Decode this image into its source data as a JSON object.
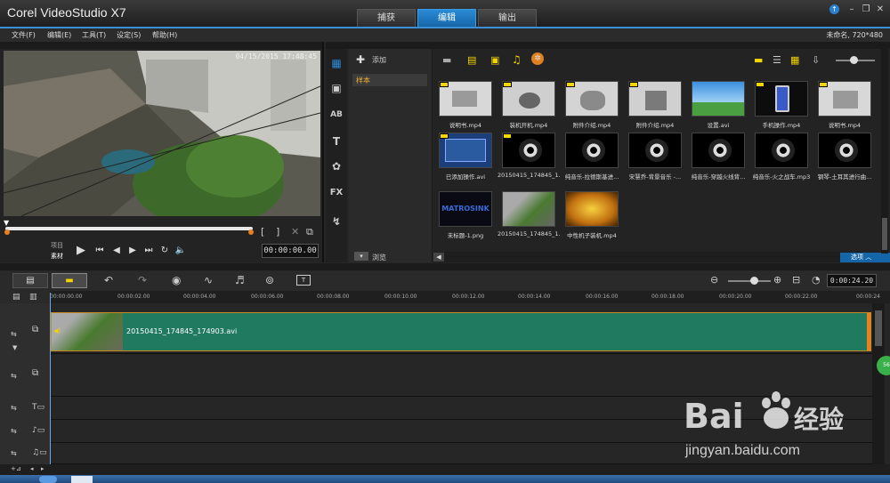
{
  "app": {
    "title": "Corel VideoStudio X7",
    "project_info": "未命名, 720*480"
  },
  "tabs": [
    {
      "label": "捕获"
    },
    {
      "label": "编辑"
    },
    {
      "label": "输出"
    }
  ],
  "menu": [
    {
      "label": "文件(F)"
    },
    {
      "label": "编辑(E)"
    },
    {
      "label": "工具(T)"
    },
    {
      "label": "设定(S)"
    },
    {
      "label": "帮助(H)"
    }
  ],
  "player": {
    "video_timestamp": "04/15/2015 17:48:45",
    "mode_project": "项目",
    "mode_clip": "素材",
    "timecode": "00:00:00.00",
    "bracket_in": "[",
    "bracket_out": "]"
  },
  "library": {
    "add_label": "添加",
    "category": "样本",
    "browse_label": "浏览",
    "options_label": "选项",
    "items": [
      {
        "label": "说明书.mp4",
        "tagged": true
      },
      {
        "label": "装机开机.mp4",
        "tagged": true
      },
      {
        "label": "附件介绍.mp4",
        "tagged": true
      },
      {
        "label": "附件介绍.mp4",
        "tagged": true
      },
      {
        "label": "设置.avi",
        "tagged": false
      },
      {
        "label": "手机操作.mp4",
        "tagged": true
      },
      {
        "label": "说明书.mp4",
        "tagged": true
      },
      {
        "label": "已添加操作.avi",
        "tagged": true
      },
      {
        "label": "20150415_174845_1...",
        "tagged": true
      },
      {
        "label": "纯音乐-拉德斯基进...",
        "tagged": false
      },
      {
        "label": "宋慧乔-背景音乐 -...",
        "tagged": false
      },
      {
        "label": "纯音乐-穿越火线背...",
        "tagged": false
      },
      {
        "label": "纯音乐-火之战车.mp3",
        "tagged": false
      },
      {
        "label": "钢琴-土耳其进行曲...",
        "tagged": false
      },
      {
        "label": "未标题-1.png",
        "tagged": false
      },
      {
        "label": "20150415_174845_1...",
        "tagged": false
      },
      {
        "label": "中性机子装机.mp4",
        "tagged": false
      }
    ]
  },
  "timeline": {
    "zoom_timecode": "0:00:24.20",
    "ruler": [
      "00:00:00.00",
      "00:00:02.00",
      "00:00:04.00",
      "00:00:06.00",
      "00:00:08.00",
      "00:00:10.00",
      "00:00:12.00",
      "00:00:14.00",
      "00:00:16.00",
      "00:00:18.00",
      "00:00:20.00",
      "00:00:22.00",
      "00:00:24"
    ],
    "clip_label": "20150415_174845_174903.avi"
  },
  "watermark": {
    "brand_left": "Bai",
    "brand_right": "经验",
    "url": "jingyan.baidu.com"
  },
  "colors": {
    "accent": "#2a8bd6",
    "clip": "#1f7a60",
    "playhead": "#e8801e",
    "tag": "#f5d400"
  }
}
